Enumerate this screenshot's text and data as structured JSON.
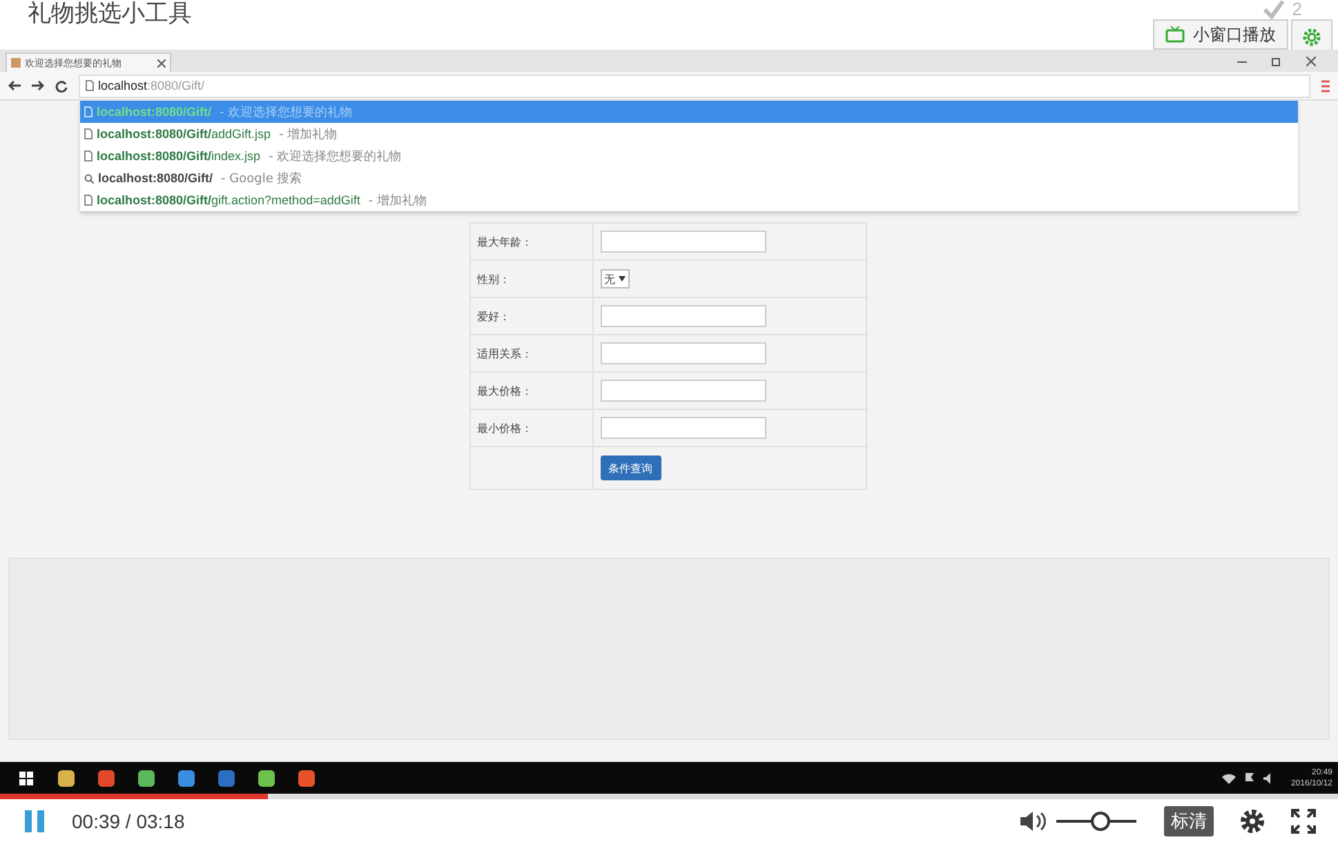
{
  "header": {
    "title": "礼物挑选小工具",
    "count": "2",
    "mini_player_button": "小窗口播放"
  },
  "browser": {
    "tab_title": "欢迎选择您想要的礼物",
    "address_host": "localhost",
    "address_rest": ":8080/Gift/",
    "suggestions": [
      {
        "kind": "page",
        "host": "localhost:8080/Gift/",
        "desc": "- 欢迎选择您想要的礼物",
        "selected": true
      },
      {
        "kind": "page",
        "host": "localhost:8080/Gift/",
        "path": "addGift.jsp",
        "desc": "- 增加礼物",
        "selected": false
      },
      {
        "kind": "page",
        "host": "localhost:8080/Gift/",
        "path": "index.jsp",
        "desc": "- 欢迎选择您想要的礼物",
        "selected": false
      },
      {
        "kind": "search",
        "host": "localhost:8080/Gift/",
        "desc": "- Google 搜索",
        "selected": false
      },
      {
        "kind": "page",
        "host": "localhost:8080/Gift/",
        "path": "gift.action?method=addGift",
        "desc": "- 增加礼物",
        "selected": false
      }
    ]
  },
  "form": {
    "rows": [
      {
        "kind": "text",
        "label": "最大年龄："
      },
      {
        "kind": "select",
        "label": "性别：",
        "value": "无"
      },
      {
        "kind": "text",
        "label": "爱好："
      },
      {
        "kind": "text",
        "label": "适用关系："
      },
      {
        "kind": "text",
        "label": "最大价格："
      },
      {
        "kind": "text",
        "label": "最小价格："
      }
    ],
    "button": "条件查询"
  },
  "taskbar": {
    "apps": [
      {
        "color": "#d9b24a"
      },
      {
        "color": "#e04a2a"
      },
      {
        "color": "#5cb85c"
      },
      {
        "color": "#3a8ee0"
      },
      {
        "color": "#2c6fc0"
      },
      {
        "color": "#6cc24a"
      },
      {
        "color": "#e8522a"
      }
    ],
    "time": "20:49",
    "date": "2016/10/12"
  },
  "player": {
    "progress": {
      "level": 0.2
    },
    "playing": true,
    "time": "00:39 / 03:18",
    "volume": {
      "level": 0.55
    },
    "quality": "标清"
  }
}
